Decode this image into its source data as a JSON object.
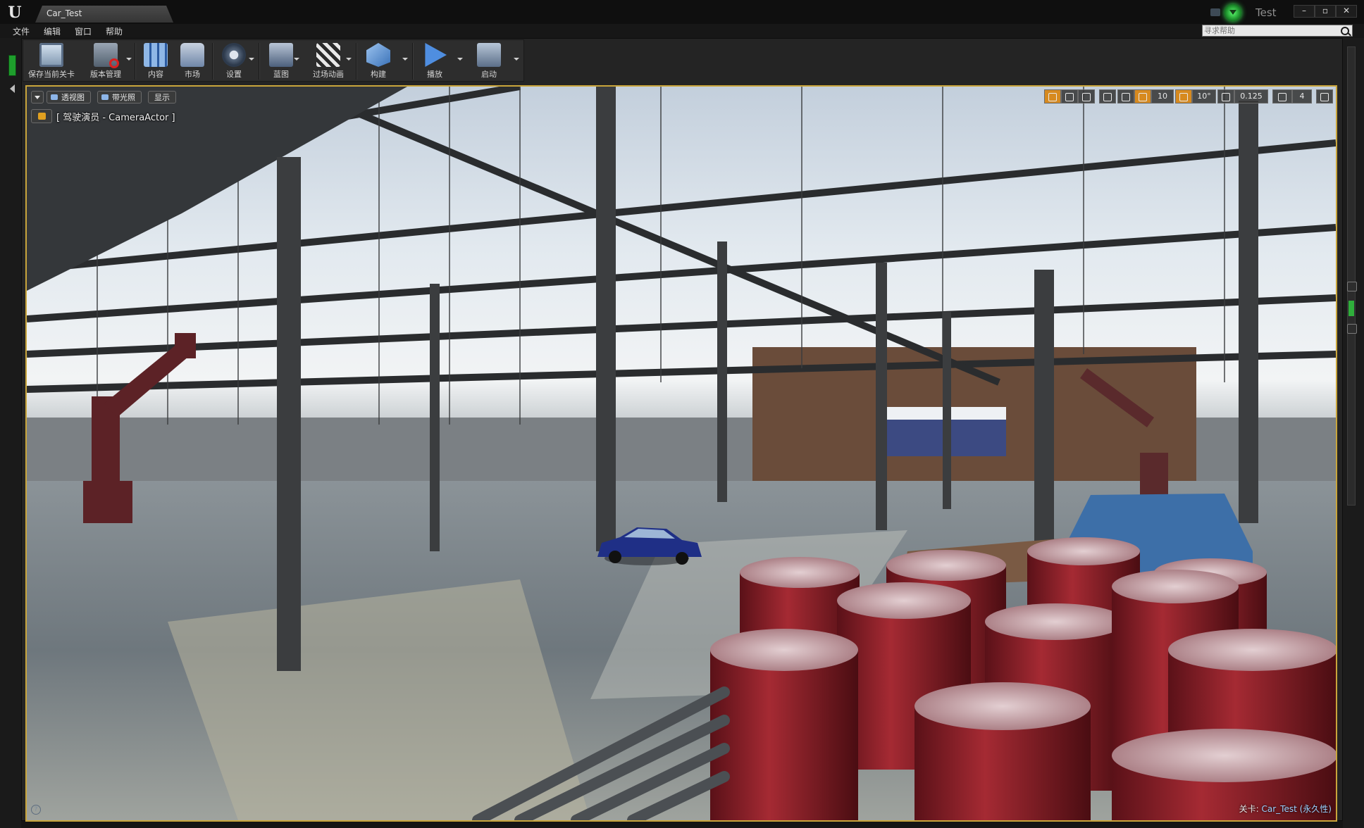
{
  "window": {
    "tab_title": "Car_Test",
    "project_name": "Test",
    "buttons": {
      "minimize": "–",
      "maximize": "▫",
      "close": "✕"
    }
  },
  "menu": {
    "items": [
      "文件",
      "编辑",
      "窗口",
      "帮助"
    ],
    "search_placeholder": "寻求帮助"
  },
  "toolbar": {
    "save": "保存当前关卡",
    "source_control": "版本管理",
    "content": "内容",
    "marketplace": "市场",
    "settings": "设置",
    "blueprints": "蓝图",
    "cinematics": "过场动画",
    "build": "构建",
    "play": "播放",
    "launch": "启动"
  },
  "viewport": {
    "perspective_label": "透视图",
    "lit_label": "带光照",
    "show_label": "显示",
    "pilot_label": "[ 驾驶演员 - CameraActor ]",
    "grid_snap": "10",
    "rotation_snap": "10°",
    "scale_snap": "0.125",
    "camera_speed": "4",
    "level_prefix": "关卡:",
    "level_name": "Car_Test (永久性)",
    "help": "?"
  },
  "colors": {
    "accent_frame": "#c9a53b",
    "source_control_active": "#3cff59",
    "active_tool": "#d78a1f",
    "barrel_red": "#8e1f27"
  }
}
